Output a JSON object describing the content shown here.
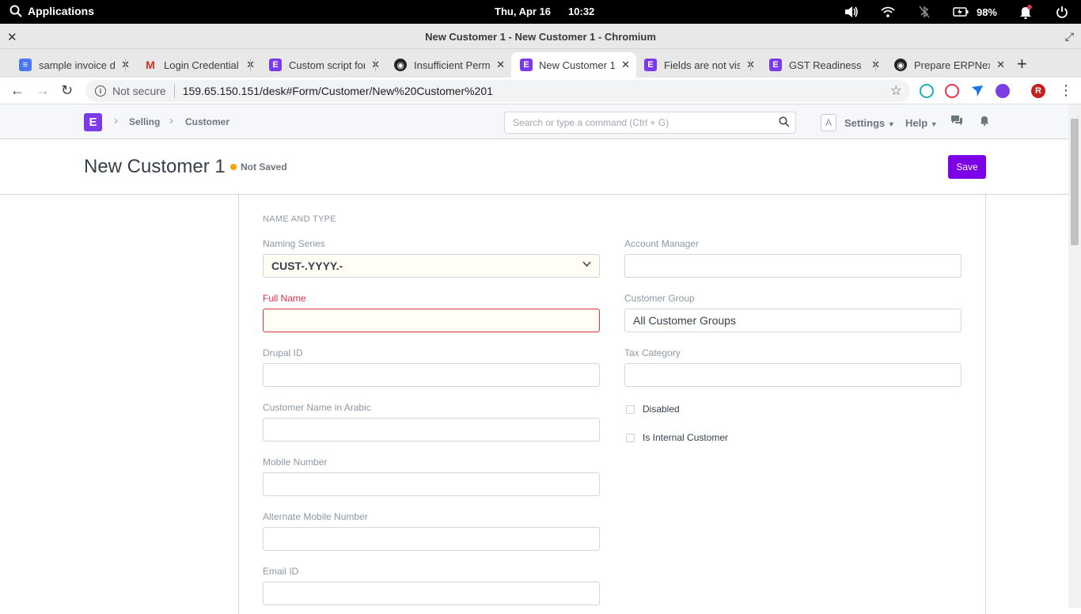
{
  "os": {
    "applications_label": "Applications",
    "date": "Thu, Apr 16",
    "time": "10:32",
    "battery": "98%"
  },
  "window": {
    "title": "New Customer 1 - New Customer 1 - Chromium"
  },
  "tabs": [
    {
      "label": "sample invoice d",
      "favicon": "docs"
    },
    {
      "label": "Login Credential",
      "favicon": "gmail"
    },
    {
      "label": "Custom script for",
      "favicon": "erpnext"
    },
    {
      "label": "Insufficient Perm",
      "favicon": "github"
    },
    {
      "label": "New Customer 1",
      "favicon": "erpnext",
      "active": true
    },
    {
      "label": "Fields are not vis",
      "favicon": "erpnext"
    },
    {
      "label": "GST Readiness Ir",
      "favicon": "erpnext"
    },
    {
      "label": "Prepare ERPNext",
      "favicon": "github"
    }
  ],
  "address": {
    "not_secure": "Not secure",
    "url": "159.65.150.151/desk#Form/Customer/New%20Customer%201"
  },
  "profile_initial": "R",
  "appnav": {
    "logo": "E",
    "breadcrumbs": [
      "Selling",
      "Customer"
    ],
    "search_placeholder": "Search or type a command (Ctrl + G)",
    "avatar": "A",
    "settings": "Settings",
    "help": "Help"
  },
  "page": {
    "title": "New Customer 1",
    "status": "Not Saved",
    "save_label": "Save"
  },
  "form": {
    "section": "NAME AND TYPE",
    "left": [
      {
        "label": "Naming Series",
        "value": "CUST-.YYYY.-",
        "type": "select"
      },
      {
        "label": "Full Name",
        "value": "",
        "type": "error"
      },
      {
        "label": "Drupal ID",
        "value": ""
      },
      {
        "label": "Customer Name in Arabic",
        "value": ""
      },
      {
        "label": "Mobile Number",
        "value": ""
      },
      {
        "label": "Alternate Mobile Number",
        "value": ""
      },
      {
        "label": "Email ID",
        "value": ""
      }
    ],
    "right": [
      {
        "label": "Account Manager",
        "value": ""
      },
      {
        "label": "Customer Group",
        "value": "All Customer Groups"
      },
      {
        "label": "Tax Category",
        "value": ""
      }
    ],
    "checks": [
      {
        "label": "Disabled",
        "checked": false
      },
      {
        "label": "Is Internal Customer",
        "checked": false
      }
    ]
  },
  "colors": {
    "brand": "#7c3aed",
    "save_button": "#7c00e6",
    "status_dot": "#ffa00a",
    "required": "#e0344b"
  }
}
